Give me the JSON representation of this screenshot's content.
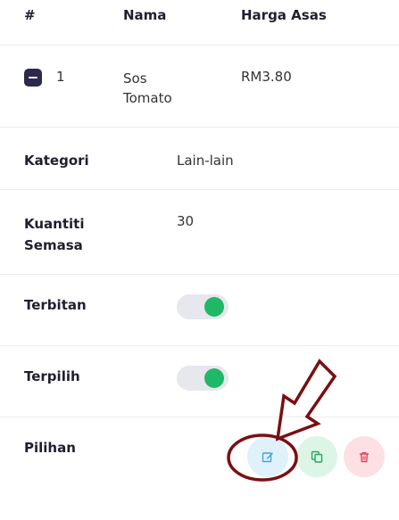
{
  "header": {
    "col_no": "#",
    "col_name": "Nama",
    "col_price": "Harga Asas"
  },
  "row": {
    "index": "1",
    "name_line1": "Sos",
    "name_line2": "Tomato",
    "price": "RM3.80"
  },
  "details": {
    "kategori_label": "Kategori",
    "kategori_value": "Lain-lain",
    "kuantiti_label_line1": "Kuantiti",
    "kuantiti_label_line2": "Semasa",
    "kuantiti_value": "30",
    "terbitan_label": "Terbitan",
    "terbitan_on": true,
    "terpilih_label": "Terpilih",
    "terpilih_on": true,
    "pilihan_label": "Pilihan"
  },
  "actions": [
    {
      "name": "edit",
      "icon": "edit-icon",
      "color": "#3fa4d8",
      "bg": "#dff1fb"
    },
    {
      "name": "copy",
      "icon": "copy-icon",
      "color": "#22a95c",
      "bg": "#dcf5e7"
    },
    {
      "name": "delete",
      "icon": "trash-icon",
      "color": "#e0455f",
      "bg": "#fde0e4"
    }
  ],
  "annotation": {
    "color": "#7a0f12"
  }
}
